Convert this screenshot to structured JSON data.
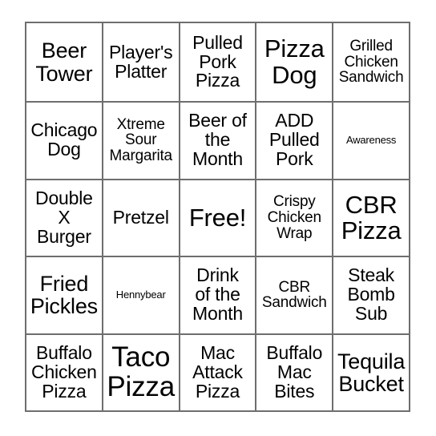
{
  "card": {
    "type": "bingo-card",
    "columns": 5,
    "rows": 5,
    "free_space": "Free!",
    "colors": {
      "background": "#ffffff",
      "grid_line": "#6e6e6e",
      "text": "#000000"
    },
    "cells": [
      {
        "text": "Beer\nTower",
        "size": "lg"
      },
      {
        "text": "Player's\nPlatter",
        "size": "md"
      },
      {
        "text": "Pulled\nPork\nPizza",
        "size": "md"
      },
      {
        "text": "Pizza\nDog",
        "size": "xl"
      },
      {
        "text": "Grilled\nChicken\nSandwich",
        "size": "sm"
      },
      {
        "text": "Chicago\nDog",
        "size": "md"
      },
      {
        "text": "Xtreme\nSour\nMargarita",
        "size": "sm"
      },
      {
        "text": "Beer of\nthe\nMonth",
        "size": "md"
      },
      {
        "text": "ADD\nPulled\nPork",
        "size": "md"
      },
      {
        "text": "Awareness",
        "size": "xs"
      },
      {
        "text": "Double\nX\nBurger",
        "size": "md"
      },
      {
        "text": "Pretzel",
        "size": "md"
      },
      {
        "text": "Free!",
        "size": "xl"
      },
      {
        "text": "Crispy\nChicken\nWrap",
        "size": "sm"
      },
      {
        "text": "CBR\nPizza",
        "size": "xl"
      },
      {
        "text": "Fried\nPickles",
        "size": "lg"
      },
      {
        "text": "Hennybear",
        "size": "xs"
      },
      {
        "text": "Drink\nof the\nMonth",
        "size": "md"
      },
      {
        "text": "CBR\nSandwich",
        "size": "sm"
      },
      {
        "text": "Steak\nBomb\nSub",
        "size": "md"
      },
      {
        "text": "Buffalo\nChicken\nPizza",
        "size": "md"
      },
      {
        "text": "Taco\nPizza",
        "size": "xxl"
      },
      {
        "text": "Mac\nAttack\nPizza",
        "size": "md"
      },
      {
        "text": "Buffalo\nMac\nBites",
        "size": "md"
      },
      {
        "text": "Tequila\nBucket",
        "size": "lg"
      }
    ]
  }
}
